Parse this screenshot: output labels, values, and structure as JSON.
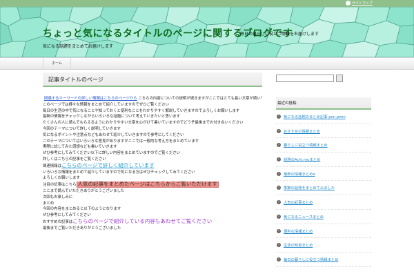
{
  "topbar": {
    "sitemap_label": "サイトマップ"
  },
  "header": {
    "title": "ちょっと気になるタイトルのページに関するブログです",
    "description": "気になる話題をまとめてお届けします",
    "right_text": "毎日の暮らしに役立つ情報をお届けします"
  },
  "nav": {
    "home_label": "ホーム"
  },
  "post": {
    "title": "記事タイトルのページ",
    "lines": [
      {
        "link": "関連するキーワードの詳しい情報はこちらのページから",
        "text": "こちらの内容についての説明が続きますがここではとても長い文章が続いています"
      },
      {
        "text": "このページでは様々な情報をまとめて紹介していますのでぜひご覧ください"
      },
      {
        "text": "毎日の生活の中で気になることや知っておくと便利なことをわかりやすく解説していきますのでよろしくお願いします"
      },
      {
        "text": "最新の情報をチェックしながらいろいろな話題について考えていきたいと思います"
      },
      {
        "text": "たくさんの人に読んでもらえるようにわかりやすい文章を心がけて書いていますのでどうぞ最後までお付き合いください"
      },
      {
        "text": "今回のテーマについて詳しく説明していきます"
      },
      {
        "text": "気になるポイントや注意点などもあわせて紹介していきますので参考にしてください"
      },
      {
        "text": "このテーマについてはいろいろな意見がありますがここでは一般的な考え方をまとめています"
      },
      {
        "text": "実際に試してみた感想なども書いていきます"
      },
      {
        "text": "ぜひ参考にしてみてください以下に詳しい内容をまとめていますのでご覧ください"
      },
      {
        "text": "詳しくはこちらの記事をご覧ください"
      },
      {
        "text": "関連情報は",
        "big_link": "こちらのページで詳しく紹介しています"
      },
      {
        "text": "いろいろな情報をまとめて紹介していますので気になる方はぜひチェックしてみてください"
      },
      {
        "text": "よろしくお願いします"
      },
      {
        "text": "注目の記事はこちら",
        "highlight": "人気の記事をまとめたページはこちらからご覧いただけます"
      },
      {
        "text": "ここまで読んでいただきありがとうございました"
      },
      {
        "text": "次回もお楽しみに"
      },
      {
        "text": "まとめ"
      },
      {
        "text": "今回の内容をまとめると以下のようになります"
      },
      {
        "text": "ぜひ参考にしてみてください"
      },
      {
        "text": "おすすめの記事は",
        "purple": "こちらのページで紹介している内容もあわせてご覧ください"
      },
      {
        "text": "最後までご覧いただきありがとうございました"
      }
    ]
  },
  "sidebar": {
    "search_placeholder": "",
    "widget_title": "最近の投稿",
    "items": [
      "気になる話題のまとめ記事 pon.pwm",
      "おすすめの情報まとめ",
      "暮らしに役立つ情報まとめ",
      "話題のAchi.muまとめ",
      "最新の情報まとめa",
      "季節の話題をまとめてみました",
      "人気の記事まとめ",
      "気になるニュースまとめ",
      "便利な情報まとめ",
      "生活の知恵まとめ",
      "毎日の暮らしに役立つ情報まとめ"
    ]
  }
}
